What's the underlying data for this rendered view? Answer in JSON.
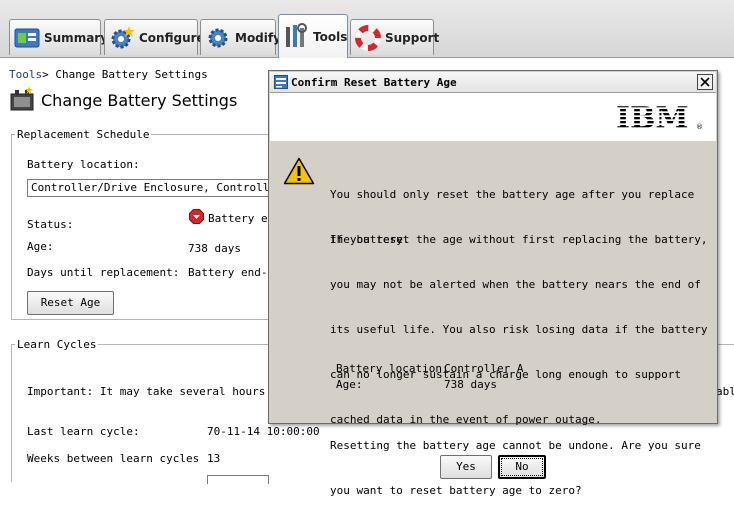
{
  "tabs": [
    {
      "label": "Summary",
      "icon": "summary-icon"
    },
    {
      "label": "Configure",
      "icon": "configure-gear-icon"
    },
    {
      "label": "Modify",
      "icon": "modify-gear-icon"
    },
    {
      "label": "Tools",
      "icon": "tools-icon",
      "active": true
    },
    {
      "label": "Support",
      "icon": "lifebuoy-icon"
    }
  ],
  "breadcrumb": {
    "root": "Tools",
    "separator": ">",
    "current": "Change Battery Settings"
  },
  "page": {
    "title": "Change Battery Settings",
    "icon": "battery-icon"
  },
  "replacement": {
    "legend": "Replacement Schedule",
    "location_label": "Battery location:",
    "location_value": "Controller/Drive Enclosure, Controller A",
    "status_label": "Status:",
    "status_value": "Battery ex",
    "age_label": "Age:",
    "age_value": "738 days",
    "days_label": "Days until replacement:",
    "days_value": "Battery end-o",
    "reset_button": "Reset Age"
  },
  "learn": {
    "legend": "Learn Cycles",
    "important_text": "Important: It may take several hours for",
    "important_tail": "abl",
    "last_label": "Last learn cycle:",
    "last_value": "70-11-14 10:00:00",
    "weeks_label": "Weeks between learn cycles",
    "weeks_value": "13"
  },
  "dialog": {
    "title": "Confirm Reset Battery Age",
    "logo": "IBM",
    "warning_icon": "warning-icon",
    "message1": [
      "You should only reset the battery age after you replace",
      "the battery."
    ],
    "message2": [
      "If you reset the age without first replacing the battery,",
      "you may not be alerted when the battery nears the end of",
      "its useful life. You also risk losing data if the battery",
      "can no longer sustain a charge long enough to support",
      "cached data in the event of power outage."
    ],
    "detail_location_label": "Battery location:",
    "detail_location_value": "Controller A",
    "detail_age_label": "Age:",
    "detail_age_value": "738 days",
    "question": [
      "Resetting the battery age cannot be undone. Are you sure",
      "you want to reset battery age to zero?"
    ],
    "yes": "Yes",
    "no": "No"
  },
  "colors": {
    "link": "#1a3d8f",
    "dialog_bg": "#d4d0c8",
    "warning": "#f5c400",
    "status_stop": "#d9262c"
  }
}
